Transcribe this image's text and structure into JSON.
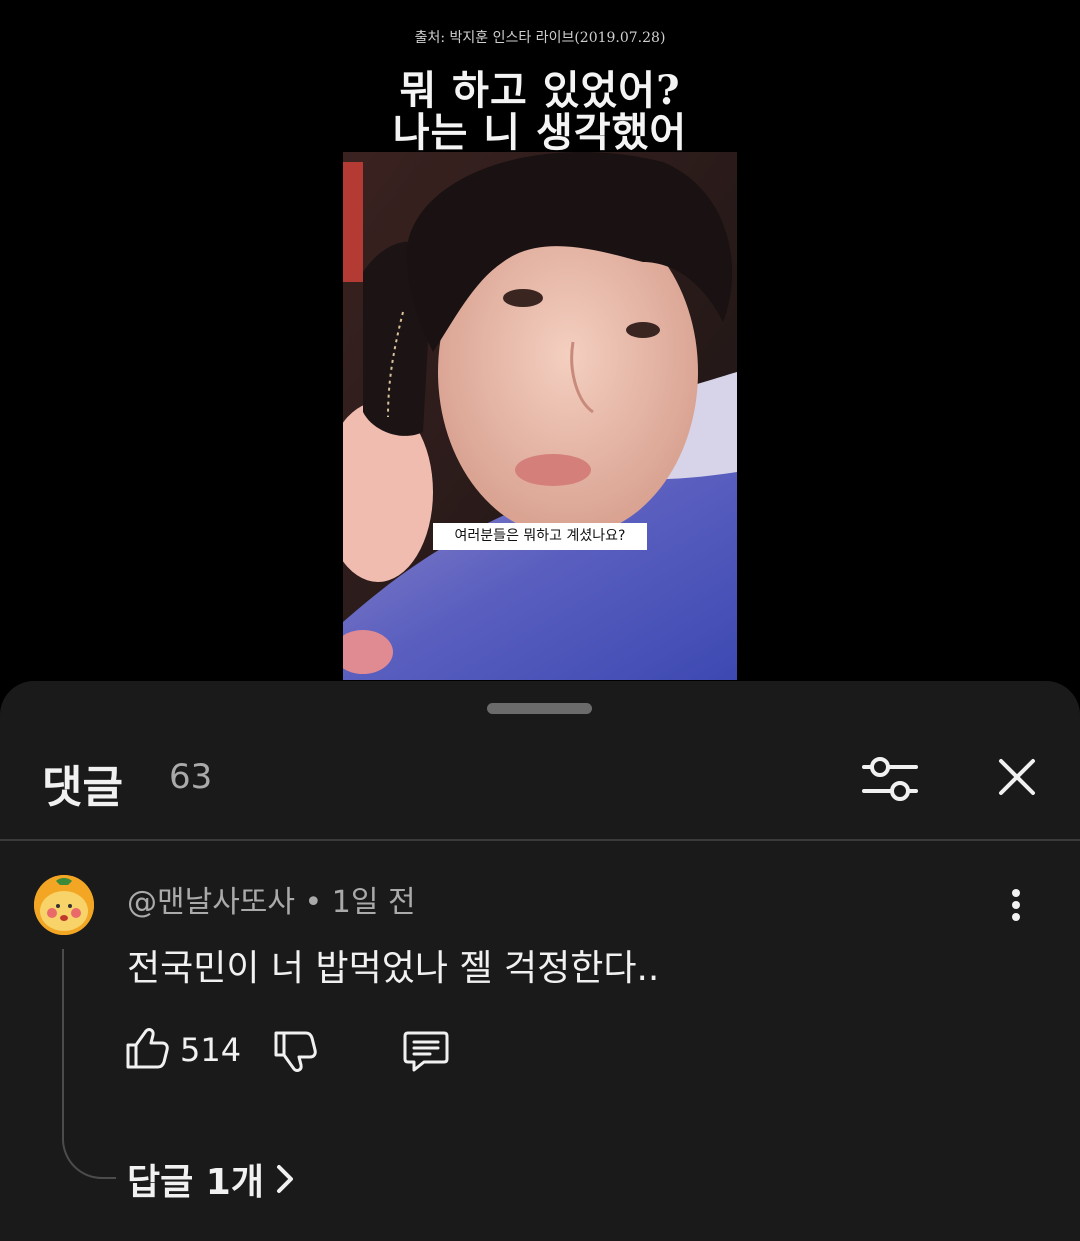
{
  "video": {
    "source_caption": "출처: 박지훈 인스타 라이브(2019.07.28)",
    "title_line1": "뭐 하고 있었어?",
    "title_line2": "나는 니 생각했어",
    "subtitle": "여러분들은 뭐하고 계셨나요?"
  },
  "comments_sheet": {
    "title": "댓글",
    "count": "63",
    "icons": {
      "filter": "sliders-icon",
      "close": "close-icon"
    }
  },
  "comment": {
    "author": "@맨날사또사",
    "separator": "•",
    "time": "1일 전",
    "text": "전국민이 너 밥먹었나 젤 걱정한다..",
    "like_count": "514",
    "replies_label": "답글 1개",
    "icons": {
      "like": "thumbs-up-icon",
      "dislike": "thumbs-down-icon",
      "reply": "comment-icon",
      "more": "more-vertical-icon",
      "replies_chevron": "chevron-right-icon"
    }
  }
}
